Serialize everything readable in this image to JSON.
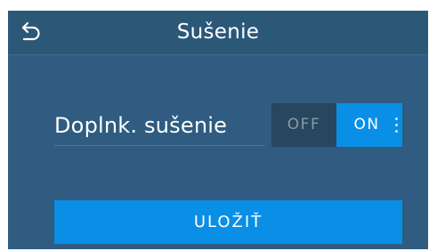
{
  "header": {
    "title": "Sušenie",
    "back_icon": "back-arrow-icon"
  },
  "setting": {
    "label": "Doplnk. sušenie",
    "toggle": {
      "off_label": "OFF",
      "on_label": "ON",
      "selected": "ON"
    }
  },
  "actions": {
    "save_label": "ULOŽIŤ"
  },
  "colors": {
    "background": "#2f5c80",
    "header": "#2c5878",
    "accent": "#0a8fe6",
    "toggle_off_bg": "#27475f",
    "text": "#ffffff"
  }
}
